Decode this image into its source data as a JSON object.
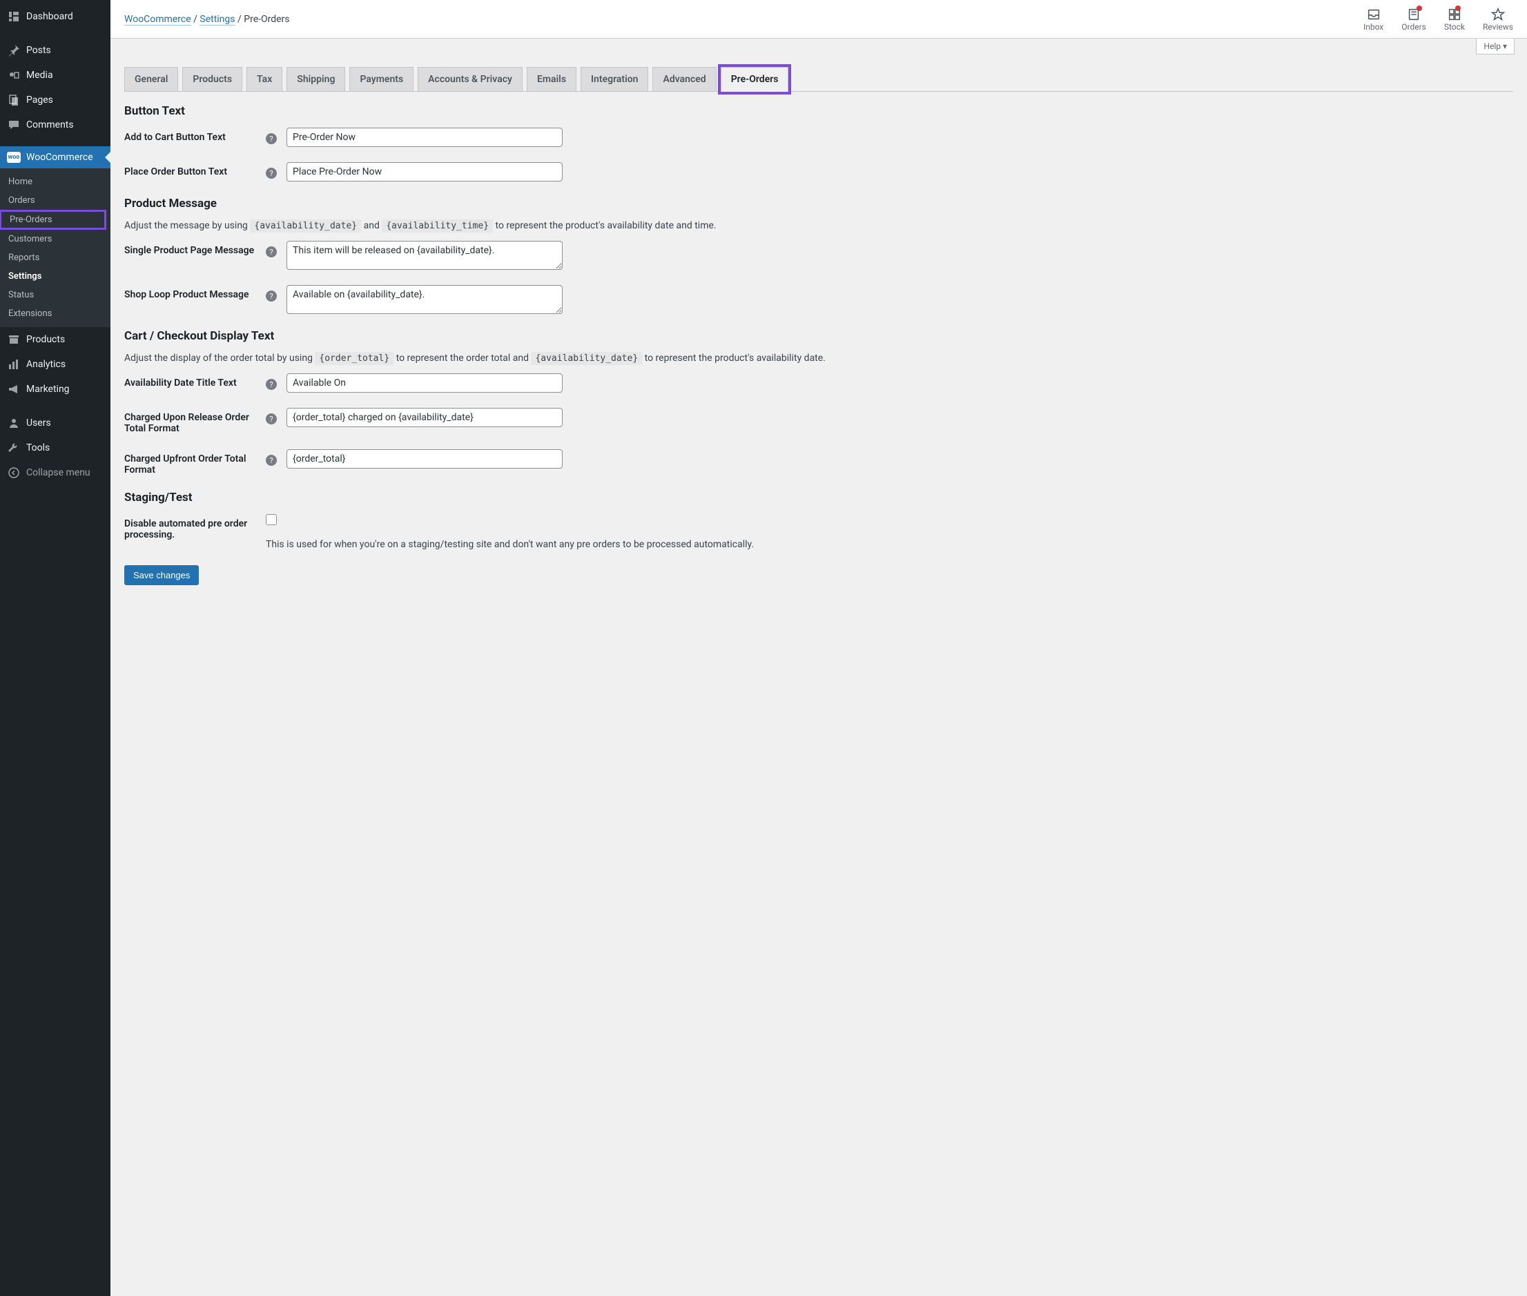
{
  "sidebar": {
    "items": [
      {
        "label": "Dashboard",
        "icon": "dashboard"
      },
      {
        "label": "Posts",
        "icon": "pin"
      },
      {
        "label": "Media",
        "icon": "media"
      },
      {
        "label": "Pages",
        "icon": "pages"
      },
      {
        "label": "Comments",
        "icon": "comment"
      },
      {
        "label": "WooCommerce",
        "icon": "woo",
        "active": true
      },
      {
        "label": "Products",
        "icon": "archive"
      },
      {
        "label": "Analytics",
        "icon": "bars"
      },
      {
        "label": "Marketing",
        "icon": "megaphone"
      },
      {
        "label": "Users",
        "icon": "user"
      },
      {
        "label": "Tools",
        "icon": "wrench"
      },
      {
        "label": "Collapse menu",
        "icon": "collapse"
      }
    ],
    "submenu": [
      {
        "label": "Home"
      },
      {
        "label": "Orders"
      },
      {
        "label": "Pre-Orders",
        "highlight": true
      },
      {
        "label": "Customers"
      },
      {
        "label": "Reports"
      },
      {
        "label": "Settings",
        "bold": true
      },
      {
        "label": "Status"
      },
      {
        "label": "Extensions"
      }
    ]
  },
  "breadcrumb": {
    "woo": "WooCommerce",
    "settings": "Settings",
    "current": "Pre-Orders",
    "sep": "/"
  },
  "topbar": {
    "icons": [
      "Inbox",
      "Orders",
      "Stock",
      "Reviews"
    ],
    "help": "Help ▾"
  },
  "tabs": [
    "General",
    "Products",
    "Tax",
    "Shipping",
    "Payments",
    "Accounts & Privacy",
    "Emails",
    "Integration",
    "Advanced",
    "Pre-Orders"
  ],
  "active_tab": "Pre-Orders",
  "sections": {
    "button_text": {
      "heading": "Button Text",
      "add_to_cart": {
        "label": "Add to Cart Button Text",
        "value": "Pre-Order Now"
      },
      "place_order": {
        "label": "Place Order Button Text",
        "value": "Place Pre-Order Now"
      }
    },
    "product_msg": {
      "heading": "Product Message",
      "desc_pre": "Adjust the message by using ",
      "tag1": "{availability_date}",
      "desc_mid": " and ",
      "tag2": "{availability_time}",
      "desc_post": " to represent the product's availability date and time.",
      "single": {
        "label": "Single Product Page Message",
        "value": "This item will be released on {availability_date}."
      },
      "shop_loop": {
        "label": "Shop Loop Product Message",
        "value": "Available on {availability_date}."
      }
    },
    "cart": {
      "heading": "Cart / Checkout Display Text",
      "desc_pre": "Adjust the display of the order total by using ",
      "tag1": "{order_total}",
      "desc_mid": " to represent the order total and ",
      "tag2": "{availability_date}",
      "desc_post": " to represent the product's availability date.",
      "avail_title": {
        "label": "Availability Date Title Text",
        "value": "Available On"
      },
      "charged_release": {
        "label": "Charged Upon Release Order Total Format",
        "value": "{order_total} charged on {availability_date}"
      },
      "charged_upfront": {
        "label": "Charged Upfront Order Total Format",
        "value": "{order_total}"
      }
    },
    "staging": {
      "heading": "Staging/Test",
      "disable": {
        "label": "Disable automated pre order processing.",
        "help": "This is used for when you're on a staging/testing site and don't want any pre orders to be processed automatically."
      }
    }
  },
  "save_button": "Save changes"
}
